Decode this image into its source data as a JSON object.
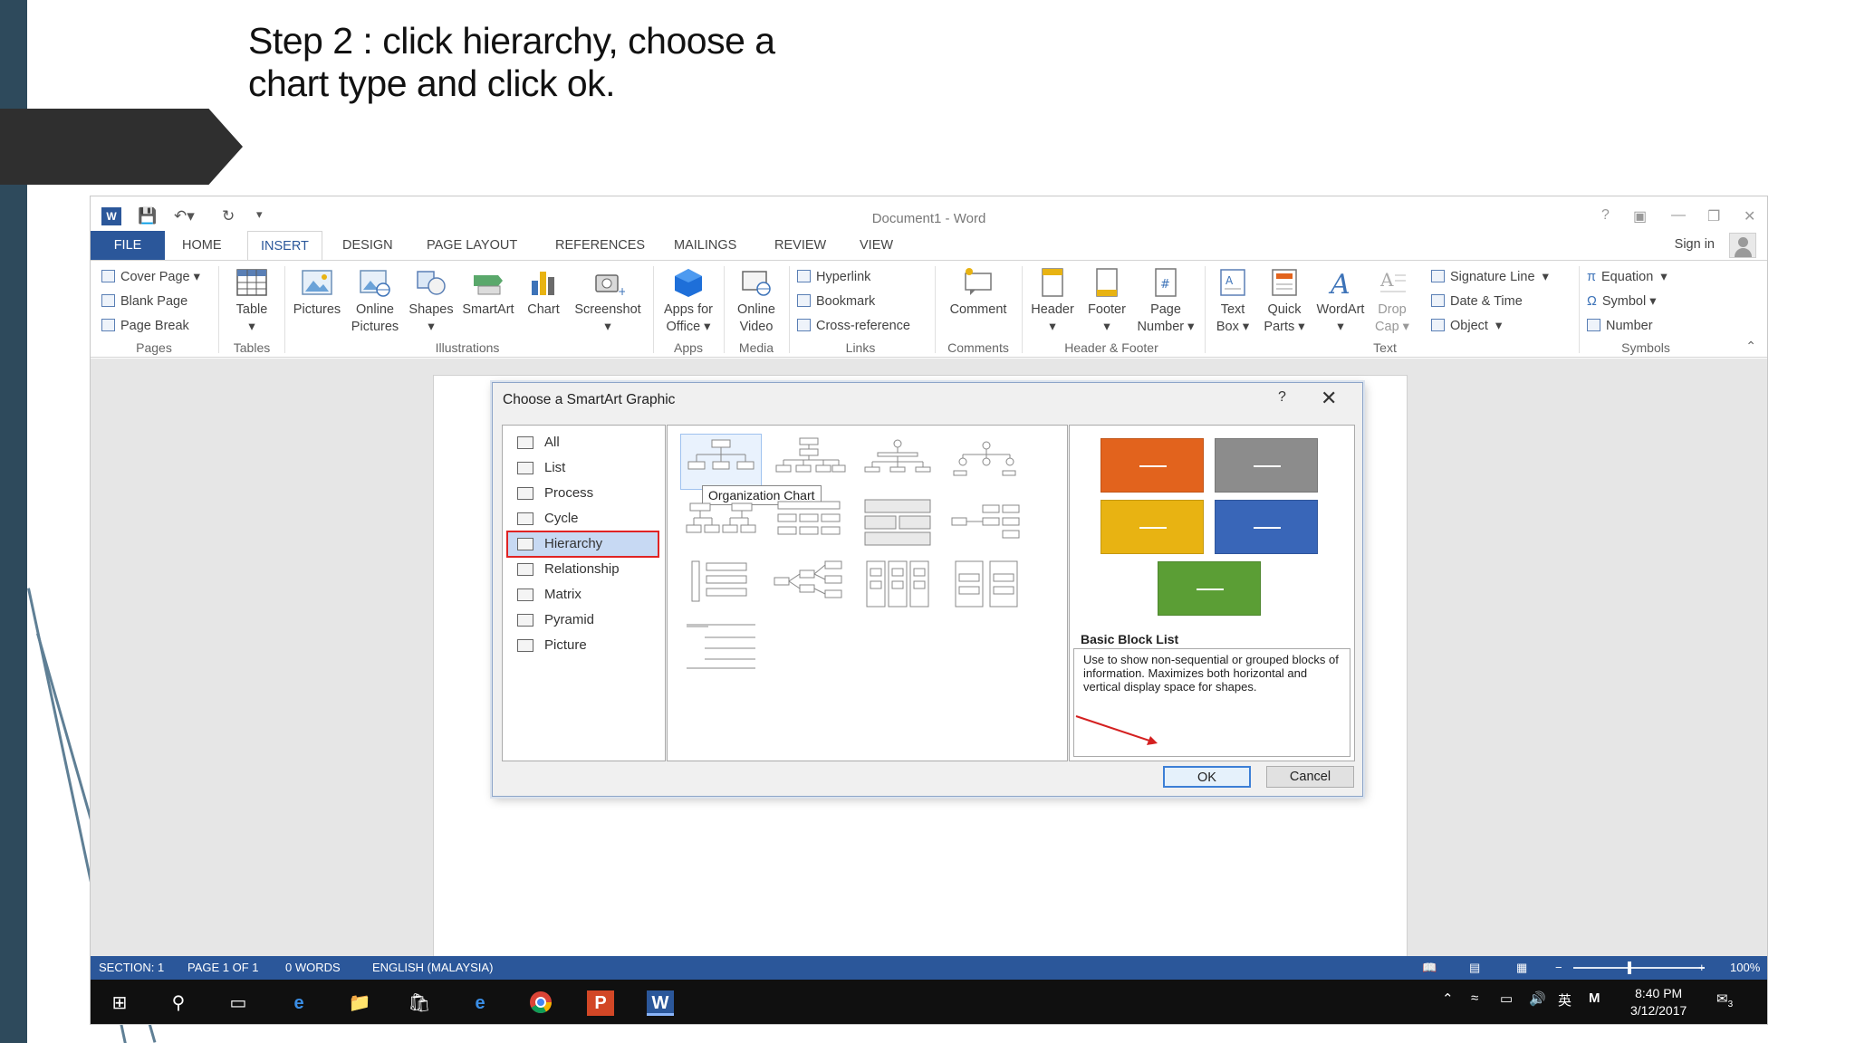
{
  "slide": {
    "title_line1": "Step 2 : click hierarchy, choose a",
    "title_line2": "chart type and click ok."
  },
  "window": {
    "title": "Document1 - Word",
    "help": "?",
    "sign_in": "Sign in"
  },
  "tabs": [
    "FILE",
    "HOME",
    "INSERT",
    "DESIGN",
    "PAGE LAYOUT",
    "REFERENCES",
    "MAILINGS",
    "REVIEW",
    "VIEW"
  ],
  "active_tab": "INSERT",
  "ribbon": {
    "pages": {
      "cover_page": "Cover Page",
      "blank_page": "Blank Page",
      "page_break": "Page Break",
      "label": "Pages"
    },
    "tables": {
      "table": "Table",
      "label": "Tables"
    },
    "illustrations": {
      "pictures": "Pictures",
      "online_pictures_1": "Online",
      "online_pictures_2": "Pictures",
      "shapes": "Shapes",
      "smartart": "SmartArt",
      "chart": "Chart",
      "screenshot": "Screenshot",
      "label": "Illustrations"
    },
    "apps": {
      "apps_1": "Apps for",
      "apps_2": "Office",
      "label": "Apps"
    },
    "media": {
      "video_1": "Online",
      "video_2": "Video",
      "label": "Media"
    },
    "links": {
      "hyperlink": "Hyperlink",
      "bookmark": "Bookmark",
      "cross_reference": "Cross-reference",
      "label": "Links"
    },
    "comments": {
      "comment": "Comment",
      "label": "Comments"
    },
    "header_footer": {
      "header": "Header",
      "footer": "Footer",
      "page_number_1": "Page",
      "page_number_2": "Number",
      "label": "Header & Footer"
    },
    "text": {
      "text_box_1": "Text",
      "text_box_2": "Box",
      "quick_parts_1": "Quick",
      "quick_parts_2": "Parts",
      "wordart": "WordArt",
      "drop_cap_1": "Drop",
      "drop_cap_2": "Cap",
      "signature_line": "Signature Line",
      "date_time": "Date & Time",
      "object": "Object",
      "label": "Text"
    },
    "symbols": {
      "equation": "Equation",
      "symbol": "Symbol",
      "number": "Number",
      "label": "Symbols"
    }
  },
  "dialog": {
    "title": "Choose a SmartArt Graphic",
    "help": "?",
    "close": "✕",
    "categories": [
      "All",
      "List",
      "Process",
      "Cycle",
      "Hierarchy",
      "Relationship",
      "Matrix",
      "Pyramid",
      "Picture"
    ],
    "selected_category": "Hierarchy",
    "hover_tooltip": "Organization Chart",
    "preview_title": "Basic Block List",
    "preview_description": "Use to show non-sequential or grouped blocks of information. Maximizes both horizontal and vertical display space for shapes.",
    "preview_colors": [
      "#e2631d",
      "#8c8c8c",
      "#e8b312",
      "#3966b8",
      "#5b9e35"
    ],
    "ok": "OK",
    "cancel": "Cancel"
  },
  "statusbar": {
    "section": "SECTION: 1",
    "page": "PAGE 1 OF 1",
    "words": "0 WORDS",
    "language": "ENGLISH (MALAYSIA)",
    "zoom": "100%"
  },
  "taskbar": {
    "time": "8:40 PM",
    "date": "3/12/2017",
    "notifications": "3"
  },
  "colors": {
    "word_blue": "#2b579a",
    "slide_sidebar": "#2e4a5c",
    "selection_outline": "#e02323"
  }
}
